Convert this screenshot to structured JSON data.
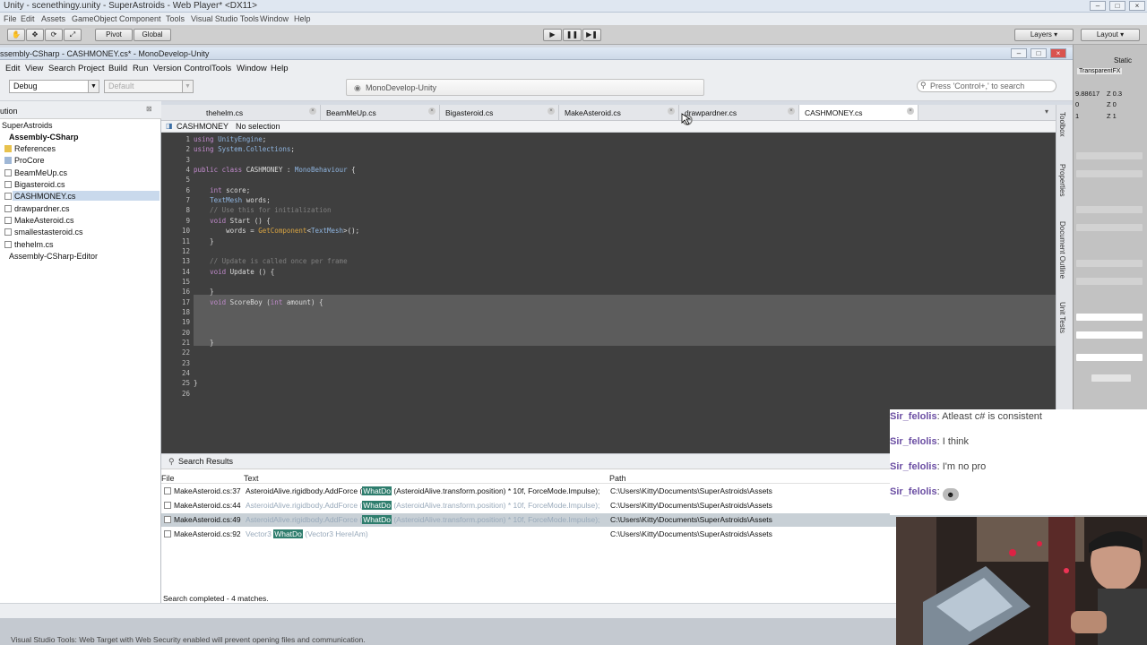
{
  "unity": {
    "window_title": "Unity - scenethingy.unity - SuperAstroids - Web Player* <DX11>",
    "menu": [
      "File",
      "Edit",
      "Assets",
      "GameObject",
      "Component",
      "Tools",
      "Visual Studio Tools",
      "Window",
      "Help"
    ],
    "toolbar": {
      "pivot": "Pivot",
      "global": "Global",
      "layers": "Layers",
      "layout": "Layout"
    },
    "inspector": {
      "static": "Static",
      "material": "TransparentFX",
      "vals": [
        "9.88617",
        "Z 0.3",
        "0",
        "Z 0",
        "1",
        "Z 1"
      ]
    },
    "status": "Visual Studio Tools: Web Target with Web Security enabled will prevent opening files and communication."
  },
  "md": {
    "window_title": "ssembly-CSharp - CASHMONEY.cs* - MonoDevelop-Unity",
    "menu": [
      "Edit",
      "View",
      "Search",
      "Project",
      "Build",
      "Run",
      "Version Control",
      "Tools",
      "Window",
      "Help"
    ],
    "config": "Debug",
    "platform": "Default",
    "status_pill": "MonoDevelop-Unity",
    "search_placeholder": "Press 'Control+,' to search",
    "solution": {
      "header": "ution",
      "items": [
        {
          "label": "SuperAstroids",
          "bold": false
        },
        {
          "label": "Assembly-CSharp",
          "bold": true
        },
        {
          "label": "References",
          "bold": false
        },
        {
          "label": "ProCore",
          "bold": false
        },
        {
          "label": "BeamMeUp.cs",
          "bold": false
        },
        {
          "label": "Bigasteroid.cs",
          "bold": false
        },
        {
          "label": "CASHMONEY.cs",
          "bold": false
        },
        {
          "label": "drawpardner.cs",
          "bold": false
        },
        {
          "label": "MakeAsteroid.cs",
          "bold": false
        },
        {
          "label": "smallestasteroid.cs",
          "bold": false
        },
        {
          "label": "thehelm.cs",
          "bold": false
        },
        {
          "label": "Assembly-CSharp-Editor",
          "bold": false
        }
      ]
    },
    "tabs": [
      "thehelm.cs",
      "BeamMeUp.cs",
      "Bigasteroid.cs",
      "MakeAsteroid.cs",
      "drawpardner.cs",
      "CASHMONEY.cs"
    ],
    "breadcrumb": {
      "class": "CASHMONEY",
      "member": "No selection"
    },
    "code_lines": [
      "using UnityEngine;",
      "using System.Collections;",
      "",
      "public class CASHMONEY : MonoBehaviour {",
      "",
      "    int score;",
      "    TextMesh words;",
      "    // Use this for initialization",
      "    void Start () {",
      "        words = GetComponent<TextMesh>();",
      "    }",
      "",
      "    // Update is called once per frame",
      "    void Update () {",
      "",
      "    }",
      "    void ScoreBoy (int amount) {",
      "",
      "",
      "",
      "    }",
      "",
      "",
      "",
      "}",
      ""
    ],
    "dock_labels": [
      "Toolbox",
      "Properties",
      "Document Outline",
      "Unit Tests"
    ],
    "search_results": {
      "title": "Search Results",
      "columns": {
        "file": "File",
        "text": "Text",
        "path": "Path"
      },
      "rows": [
        {
          "file": "MakeAsteroid.cs:37",
          "pre": "AsteroidAlive.rigidbody.AddForce (",
          "hit": "WhatDo",
          "post": " (AsteroidAlive.transform.position) * 10f, ForceMode.Impulse);",
          "path": "C:\\Users\\Kitty\\Documents\\SuperAstroids\\Assets"
        },
        {
          "file": "MakeAsteroid.cs:44",
          "pre": "AsteroidAlive.rigidbody.AddForce (",
          "hit": "WhatDo",
          "post": " (AsteroidAlive.transform.position) * 10f, ForceMode.Impulse);",
          "path": "C:\\Users\\Kitty\\Documents\\SuperAstroids\\Assets"
        },
        {
          "file": "MakeAsteroid.cs:49",
          "pre": "AsteroidAlive.rigidbody.AddForce (",
          "hit": "WhatDo",
          "post": " (AsteroidAlive.transform.position) * 10f, ForceMode.Impulse);",
          "path": "C:\\Users\\Kitty\\Documents\\SuperAstroids\\Assets"
        },
        {
          "file": "MakeAsteroid.cs:92",
          "pre": "Vector3 ",
          "hit": "WhatDo",
          "post": " (Vector3 HereIAm)",
          "path": "C:\\Users\\Kitty\\Documents\\SuperAstroids\\Assets"
        }
      ],
      "status": "Search completed - 4 matches."
    }
  },
  "chat": [
    {
      "user": "Sir_felolis",
      "text": "Atleast c# is consistent"
    },
    {
      "user": "Sir_felolis",
      "text": "I think"
    },
    {
      "user": "Sir_felolis",
      "text": "I'm no pro"
    },
    {
      "user": "Sir_felolis",
      "text": ""
    }
  ],
  "colors": {
    "editor_bg": "#3f3f3f",
    "keyword": "#c08acb",
    "type": "#8fb5e0",
    "comment": "#7f7f7f",
    "chat_user": "#6b4ea3",
    "search_hit": "#2e7d6d"
  }
}
